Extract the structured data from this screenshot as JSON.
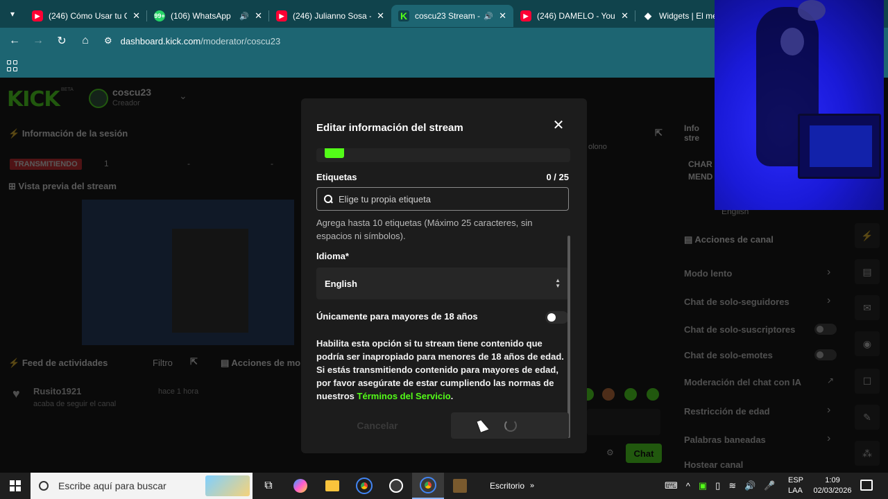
{
  "browser": {
    "tabs": [
      {
        "title": "(246) Cómo Usar tu C",
        "favicon": "youtube-icon",
        "audio": false,
        "active": false
      },
      {
        "title": "(106) WhatsApp",
        "favicon": "whatsapp-icon",
        "audio": true,
        "active": false
      },
      {
        "title": "(246) Julianno Sosa -",
        "favicon": "youtube-icon",
        "audio": false,
        "active": false
      },
      {
        "title": "coscu23 Stream -",
        "favicon": "kick-icon",
        "audio": true,
        "active": true
      },
      {
        "title": "(246) DAMELO - YouT",
        "favicon": "youtube-icon",
        "audio": false,
        "active": false
      },
      {
        "title": "Widgets | El mejor s",
        "favicon": "widgets-icon",
        "audio": false,
        "active": false
      }
    ],
    "whatsapp_badge": "99+",
    "url_host": "dashboard.kick.com",
    "url_path": "/moderator/coscu23"
  },
  "dashboard": {
    "logo": "KICK",
    "logo_badge": "BETA",
    "channel_name": "coscu23",
    "channel_role": "Creador",
    "session_title": "Información de la sesión",
    "live_badge": "TRANSMITIENDO",
    "stats": [
      "1",
      "-",
      "-"
    ],
    "preview_title": "Vista previa del stream",
    "feed_title": "Feed de actividades",
    "feed_filter": "Filtro",
    "feed_user": "Rusito1921",
    "feed_action": "acaba de seguir el canal",
    "feed_time": "hace 1 hora",
    "mod_actions_title": "Acciones de mo",
    "chat_peek": "olono",
    "chat_button": "Chat",
    "right_info_title": "Info stre",
    "right_stream_title": "CHAR MEND",
    "right_lang": "English",
    "channel_actions_title": "Acciones de canal",
    "channel_actions": [
      {
        "label": "Modo lento",
        "kind": "arrow"
      },
      {
        "label": "Chat de solo-seguidores",
        "kind": "arrow"
      },
      {
        "label": "Chat de solo-suscriptores",
        "kind": "toggle"
      },
      {
        "label": "Chat de solo-emotes",
        "kind": "toggle"
      },
      {
        "label": "Moderación del chat con IA",
        "kind": "external"
      },
      {
        "label": "Restricción de edad",
        "kind": "arrow"
      },
      {
        "label": "Palabras baneadas",
        "kind": "arrow"
      },
      {
        "label": "Hostear canal",
        "kind": "none"
      }
    ]
  },
  "modal": {
    "title": "Editar información del stream",
    "tags_label": "Etiquetas",
    "tags_count": "0 / 25",
    "tags_placeholder": "Elige tu propia etiqueta",
    "tags_help": "Agrega hasta 10 etiquetas (Máximo 25 caracteres, sin espacios ni símbolos).",
    "language_label": "Idioma*",
    "language_value": "English",
    "adult_label": "Únicamente para mayores de 18 años",
    "adult_enabled": false,
    "adult_desc": "Habilita esta opción si tu stream tiene contenido que podría ser inapropiado para menores de 18 años de edad. Si estás transmitiendo contenido para mayores de edad, por favor asegúrate de estar cumpliendo las normas de nuestros",
    "terms_link": "Términos del Servicio",
    "terms_end": ".",
    "cancel_label": "Cancelar"
  },
  "taskbar": {
    "search_placeholder": "Escribe aquí para buscar",
    "desktop_label": "Escritorio",
    "lang_top": "ESP",
    "lang_bottom": "LAA",
    "time": "1:09",
    "date": "02/03/2026"
  },
  "colors": {
    "accent": "#53fc18",
    "chrome": "#10434c",
    "chrome_active": "#1d6572",
    "modal_bg": "#1c1c1c",
    "live_red": "#e0282e"
  }
}
